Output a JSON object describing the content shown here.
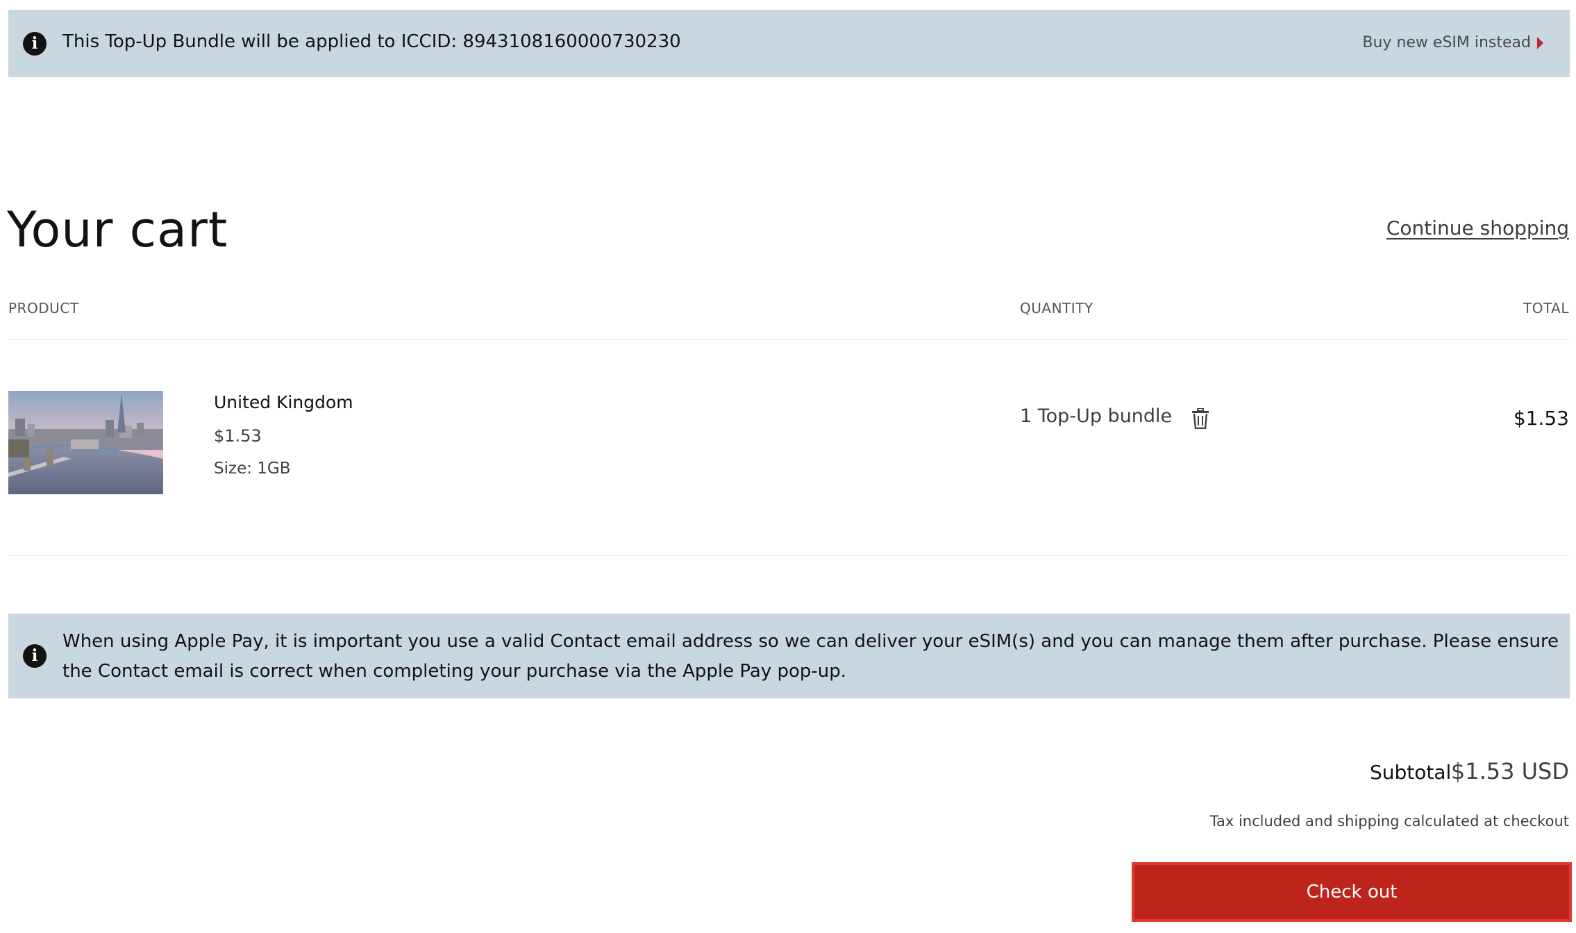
{
  "topup_banner": {
    "icon": "info-icon",
    "message": "This Top-Up Bundle will be applied to ICCID: 8943108160000730230",
    "link_label": "Buy new eSIM instead"
  },
  "cart": {
    "title": "Your cart",
    "continue_label": "Continue shopping",
    "columns": {
      "product": "PRODUCT",
      "quantity": "QUANTITY",
      "total": "TOTAL"
    },
    "items": [
      {
        "name": "United Kingdom",
        "price": "$1.53",
        "size": "Size: 1GB",
        "quantity": "1 Top-Up bundle",
        "total": "$1.53",
        "image": "london-skyline-tower-bridge"
      }
    ]
  },
  "apple_pay_notice": {
    "icon": "info-icon",
    "message": "When using Apple Pay, it is important you use a valid Contact email address so we can deliver your eSIM(s) and you can manage them after purchase. Please ensure the Contact email is correct when completing your purchase via the Apple Pay pop-up."
  },
  "summary": {
    "subtotal_label": "Subtotal",
    "subtotal_value": "$1.53 USD",
    "tax_note": "Tax included and shipping calculated at checkout",
    "checkout_label": "Check out"
  },
  "colors": {
    "banner_bg": "#c9d7e0",
    "accent": "#bd241b",
    "text": "#121212"
  }
}
